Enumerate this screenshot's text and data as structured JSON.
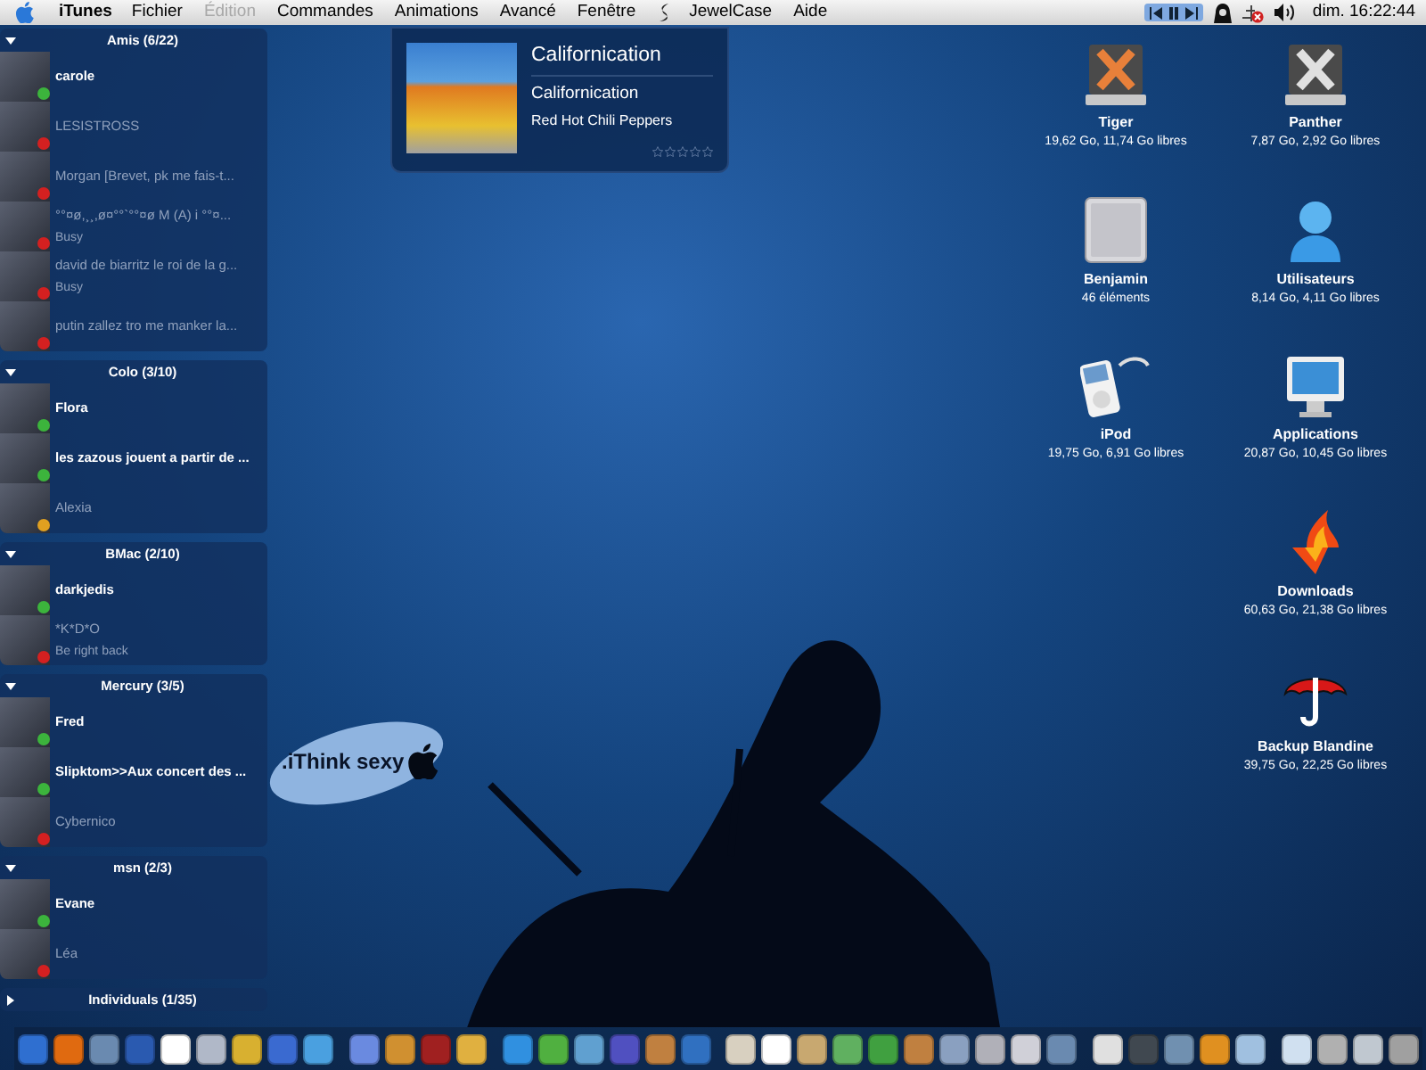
{
  "menu_bar": {
    "app": "iTunes",
    "menus": [
      {
        "label": "Fichier",
        "disabled": false
      },
      {
        "label": "Édition",
        "disabled": true
      },
      {
        "label": "Commandes",
        "disabled": false
      },
      {
        "label": "Animations",
        "disabled": false
      },
      {
        "label": "Avancé",
        "disabled": false
      },
      {
        "label": "Fenêtre",
        "disabled": false
      }
    ],
    "extra_menus": [
      "JewelCase",
      "Aide"
    ],
    "clock": "dim. 16:22:44"
  },
  "buddy_list": {
    "groups": [
      {
        "title": "Amis (6/22)",
        "expanded": true,
        "contacts": [
          {
            "name": "carole",
            "idle": false,
            "color": "#3cb43c"
          },
          {
            "name": "LESISTROSS",
            "idle": true,
            "color": "#d42020"
          },
          {
            "name": "Morgan [Brevet, pk me fais-t...",
            "idle": true,
            "color": "#d42020"
          },
          {
            "name": "°°¤ø,¸¸,ø¤°°`°°¤ø M (A) i °°¤...",
            "status": "Busy",
            "idle": true,
            "color": "#d42020"
          },
          {
            "name": "david de biarritz le roi de la g...",
            "status": "Busy",
            "idle": true,
            "color": "#d42020"
          },
          {
            "name": "putin zallez tro me manker la...",
            "idle": true,
            "color": "#d42020"
          }
        ]
      },
      {
        "title": "Colo (3/10)",
        "expanded": true,
        "contacts": [
          {
            "name": "Flora",
            "idle": false,
            "color": "#3cb43c"
          },
          {
            "name": "les zazous jouent a partir de ...",
            "idle": false,
            "color": "#3cb43c"
          },
          {
            "name": "Alexia",
            "idle": true,
            "color": "#e0a020"
          }
        ]
      },
      {
        "title": "BMac (2/10)",
        "expanded": true,
        "contacts": [
          {
            "name": "darkjedis",
            "idle": false,
            "color": "#3cb43c"
          },
          {
            "name": "*K*D*O",
            "status": "Be right back",
            "idle": true,
            "color": "#d42020"
          }
        ]
      },
      {
        "title": "Mercury (3/5)",
        "expanded": true,
        "contacts": [
          {
            "name": "Fred",
            "idle": false,
            "color": "#3cb43c"
          },
          {
            "name": "Slipktom>>Aux concert des ...",
            "idle": false,
            "color": "#3cb43c"
          },
          {
            "name": "Cybernico",
            "idle": true,
            "color": "#d42020"
          }
        ]
      },
      {
        "title": "msn (2/3)",
        "expanded": true,
        "contacts": [
          {
            "name": "Evane",
            "idle": false,
            "color": "#3cb43c"
          },
          {
            "name": "Léa",
            "idle": true,
            "color": "#d42020"
          }
        ]
      },
      {
        "title": "Individuals (1/35)",
        "expanded": false
      }
    ]
  },
  "now_playing": {
    "title": "Californication",
    "track": "Californication",
    "artist": "Red Hot Chili Peppers",
    "stars": 0
  },
  "wallpaper_text": ".iThink sexy",
  "desktop_icon_rows": [
    [
      {
        "kind": "drive-orange",
        "name": "Tiger",
        "info": "19,62 Go, 11,74 Go libres"
      },
      {
        "kind": "drive-grey",
        "name": "Panther",
        "info": "7,87 Go, 2,92 Go libres"
      }
    ],
    [
      {
        "kind": "tower",
        "name": "Benjamin",
        "info": "46 éléments"
      },
      {
        "kind": "user",
        "name": "Utilisateurs",
        "info": "8,14 Go, 4,11 Go libres"
      }
    ],
    [
      {
        "kind": "ipod",
        "name": "iPod",
        "info": "19,75 Go, 6,91 Go libres"
      },
      {
        "kind": "monitor",
        "name": "Applications",
        "info": "20,87 Go, 10,45 Go libres"
      }
    ],
    [
      {
        "kind": "flame",
        "name": "Downloads",
        "info": "60,63 Go, 21,38 Go libres"
      }
    ],
    [
      {
        "kind": "umbrella",
        "name": "Backup Blandine",
        "info": "39,75 Go, 22,25 Go libres"
      }
    ]
  ]
}
